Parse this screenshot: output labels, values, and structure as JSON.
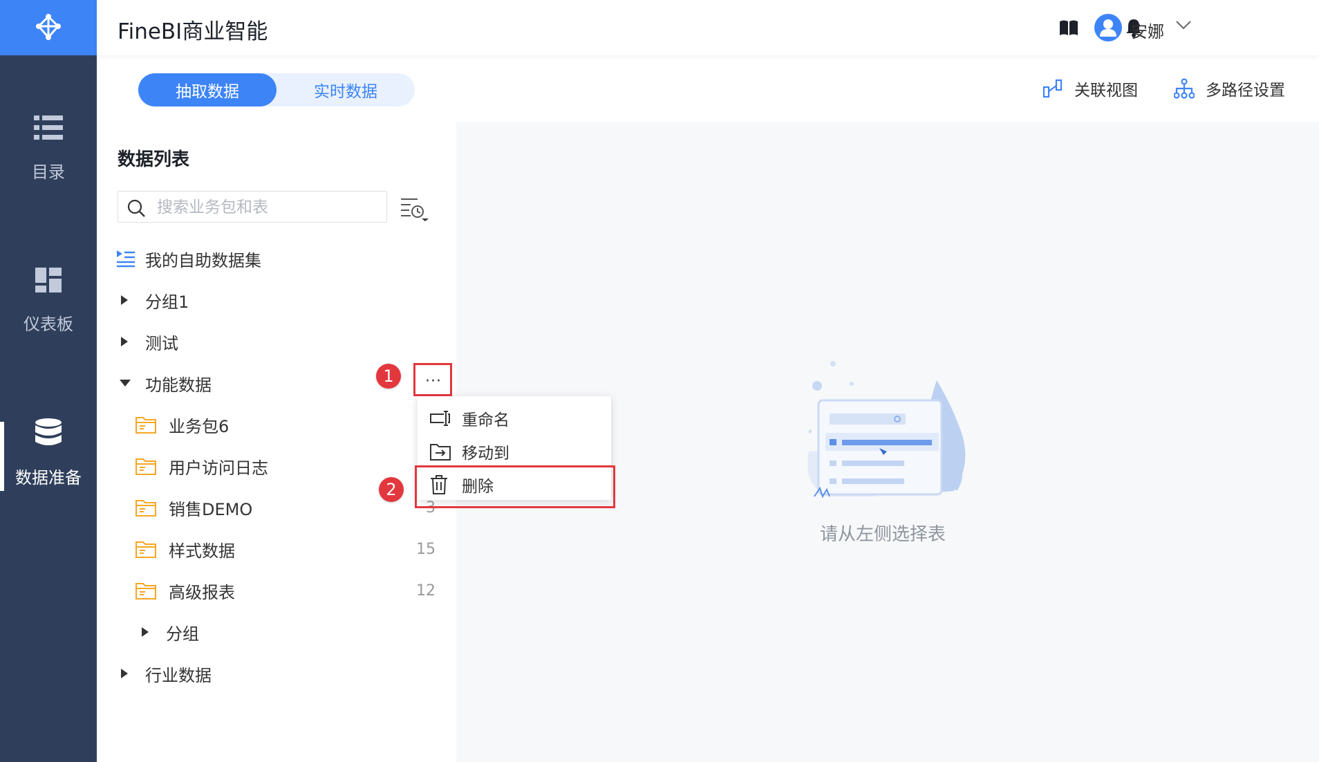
{
  "app": {
    "title": "FineBI商业智能"
  },
  "nav": {
    "items": [
      {
        "label": "目录",
        "icon": "list-icon"
      },
      {
        "label": "仪表板",
        "icon": "dashboard-icon"
      },
      {
        "label": "数据准备",
        "icon": "database-icon",
        "active": true
      }
    ]
  },
  "header": {
    "user": "安娜",
    "icons": [
      "book-icon",
      "bell-icon",
      "user-icon",
      "chevron-down-icon"
    ]
  },
  "tabs": [
    {
      "label": "抽取数据",
      "active": true
    },
    {
      "label": "实时数据",
      "active": false
    }
  ],
  "actions": {
    "relation_view": "关联视图",
    "multipath": "多路径设置"
  },
  "panel": {
    "title": "数据列表",
    "search_placeholder": "搜索业务包和表",
    "tree": [
      {
        "label": "我的自助数据集",
        "icon": "self-dataset-icon"
      },
      {
        "label": "分组1",
        "expanded": false
      },
      {
        "label": "测试",
        "expanded": false
      },
      {
        "label": "功能数据",
        "expanded": true
      },
      {
        "label": "业务包6",
        "count": ""
      },
      {
        "label": "用户访问日志",
        "count": ""
      },
      {
        "label": "销售DEMO",
        "count": "3"
      },
      {
        "label": "样式数据",
        "count": "15"
      },
      {
        "label": "高级报表",
        "count": "12"
      },
      {
        "label": "分组",
        "expanded": false
      },
      {
        "label": "行业数据",
        "expanded": false
      }
    ],
    "more_label": "···"
  },
  "context_menu": {
    "items": [
      {
        "label": "重命名",
        "icon": "rename-icon"
      },
      {
        "label": "移动到",
        "icon": "move-to-icon"
      },
      {
        "label": "删除",
        "icon": "trash-icon"
      }
    ]
  },
  "annotations": {
    "step1": "1",
    "step2": "2"
  },
  "empty_state": {
    "text": "请从左侧选择表"
  },
  "colors": {
    "primary": "#3d84f7",
    "sidebar": "#2f3f5b",
    "annotation": "#e3373e",
    "folder": "#f5a623"
  }
}
